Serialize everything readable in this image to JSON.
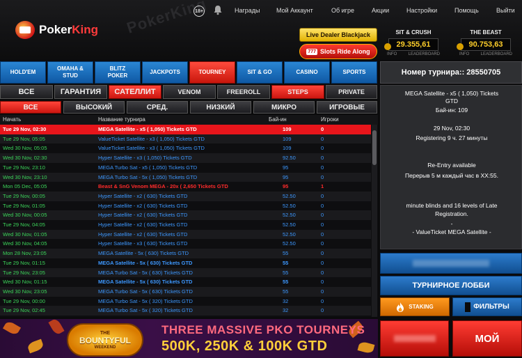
{
  "header": {
    "logo_poker": "Poker",
    "logo_king": "King",
    "watermark": "PokerKing",
    "age": "18+",
    "nav": [
      "Награды",
      "Мой Аккаунт",
      "Об игре",
      "Акции",
      "Настройки",
      "Помощь",
      "Выйти"
    ],
    "live_dealer": "Live Dealer Blackjack",
    "slots_ride": "Slots Ride Along",
    "slots_777": "777",
    "jackpots": [
      {
        "title": "SIT & CRUSH",
        "amount": "29.355,61",
        "info": "INFO",
        "leaderboard": "LEADERBOARD"
      },
      {
        "title": "THE BEAST",
        "amount": "90.753,63",
        "info": "INFO",
        "leaderboard": "LEADERBOARD"
      }
    ]
  },
  "game_tabs": [
    "HOLD'EM",
    "OMAHA & STUD",
    "BLITZ POKER",
    "JACKPOTS",
    "TOURNEY",
    "SIT & GO",
    "CASINO",
    "SPORTS"
  ],
  "filter_row1": [
    "ВСЕ",
    "ГАРАНТИЯ",
    "САТЕЛЛИТ",
    "VENOM",
    "FREEROLL",
    "STEPS",
    "PRIVATE"
  ],
  "filter_row2": [
    "ВСЕ",
    "ВЫСОКИЙ",
    "СРЕД.",
    "НИЗКИЙ",
    "МИКРО",
    "ИГРОВЫЕ"
  ],
  "table": {
    "headers": {
      "start": "Начать",
      "name": "Название турнира",
      "buyin": "Бай-ин",
      "players": "Игроки"
    },
    "rows": [
      {
        "start": "Tue 29 Nov, 02:30",
        "name": "MEGA Satellite - x5 (  1,050) Tickets GTD",
        "buyin": "109",
        "players": "0"
      },
      {
        "start": "Tue 29 Nov, 05:05",
        "name": "ValueTicket Satellite - x3 (  1,050) Tickets GTD",
        "buyin": "109",
        "players": "0"
      },
      {
        "start": "Wed 30 Nov, 05:05",
        "name": "ValueTicket Satellite - x3 (  1,050) Tickets GTD",
        "buyin": "109",
        "players": "0"
      },
      {
        "start": "Wed 30 Nov, 02:30",
        "name": "Hyper Satellite - x3 (  1,050) Tickets GTD",
        "buyin": "92.50",
        "players": "0"
      },
      {
        "start": "Tue 29 Nov, 23:10",
        "name": "MEGA Turbo Sat - x5 (  1,050) Tickets GTD",
        "buyin": "95",
        "players": "0"
      },
      {
        "start": "Wed 30 Nov, 23:10",
        "name": "MEGA Turbo Sat - 5x (  1,050) Tickets GTD",
        "buyin": "95",
        "players": "0"
      },
      {
        "start": "Mon 05 Dec, 05:05",
        "name": "Beast & SnG Venom MEGA - 20x (  2,650 Tickets GTD",
        "buyin": "95",
        "players": "1"
      },
      {
        "start": "Tue 29 Nov, 00:05",
        "name": "Hyper Satellite - x2 (  630) Tickets GTD",
        "buyin": "52.50",
        "players": "0"
      },
      {
        "start": "Tue 29 Nov, 01:05",
        "name": "Hyper Satellite - x2 (  630) Tickets GTD",
        "buyin": "52.50",
        "players": "0"
      },
      {
        "start": "Wed 30 Nov, 00:05",
        "name": "Hyper Satellite - x2 (  630) Tickets GTD",
        "buyin": "52.50",
        "players": "0"
      },
      {
        "start": "Tue 29 Nov, 04:05",
        "name": "Hyper Satellite - x2 (  630) Tickets GTD",
        "buyin": "52.50",
        "players": "0"
      },
      {
        "start": "Wed 30 Nov, 01:05",
        "name": "Hyper Satellite - x2 (  630) Tickets GTD",
        "buyin": "52.50",
        "players": "0"
      },
      {
        "start": "Wed 30 Nov, 04:05",
        "name": "Hyper Satellite - x3 (  630) Tickets GTD",
        "buyin": "52.50",
        "players": "0"
      },
      {
        "start": "Mon 28 Nov, 23:05",
        "name": "MEGA Satellite - 5x (  630) Tickets GTD",
        "buyin": "55",
        "players": "0"
      },
      {
        "start": "Tue 29 Nov, 01:15",
        "name": "MEGA Satellite - 5x (  630) Tickets GTD",
        "buyin": "55",
        "players": "0"
      },
      {
        "start": "Tue 29 Nov, 23:05",
        "name": "MEGA Turbo Sat - 5x (  630) Tickets GTD",
        "buyin": "55",
        "players": "0"
      },
      {
        "start": "Wed 30 Nov, 01:15",
        "name": "MEGA Satellite - 5x (  630) Tickets GTD",
        "buyin": "55",
        "players": "0"
      },
      {
        "start": "Wed 30 Nov, 23:05",
        "name": "MEGA Turbo Sat - 5x (  630) Tickets GTD",
        "buyin": "55",
        "players": "0"
      },
      {
        "start": "Tue 29 Nov, 00:00",
        "name": "MEGA Turbo Sat - 5x (  320) Tickets GTD",
        "buyin": "32",
        "players": "0"
      },
      {
        "start": "Tue 29 Nov, 02:45",
        "name": "MEGA Turbo Sat - 5x (  320) Tickets GTD",
        "buyin": "32",
        "players": "0"
      },
      {
        "start": "Wed 30 Nov, 00:00",
        "name": "MEGA Turbo Sat - 5x (  320) Tickets GTD",
        "buyin": "32",
        "players": "0"
      }
    ]
  },
  "details": {
    "title": "Номер турнира:: 28550705",
    "name_line1": "MEGA Satellite - x5 (  1,050) Tickets",
    "name_line2": "GTD",
    "buyin": "Бай-ин:  109",
    "date": "29 Nov, 02:30",
    "registering": "Registering    9 ч. 27 минуты",
    "reentry": "Re-Entry available",
    "break": "Перерыв 5 м каждый час в XX:55.",
    "blinds_line1": "minute blinds and 16 levels of Late",
    "blinds_line2": "Registration.",
    "dash": "-",
    "value_line": "- ValueTicket MEGA Satellite -"
  },
  "buttons": {
    "lobby": "ТУРНИРНОЕ ЛОББИ",
    "staking": "STAKING",
    "filters": "ФИЛЬТРЫ",
    "my": "МОЙ"
  },
  "banner": {
    "badge_top": "THE",
    "badge_main": "BOUNTYFUL",
    "badge_bottom": "WEEKEND",
    "line1": "THREE MASSIVE PKO TOURNEYS",
    "line2": "500K, 250K & 100K GTD"
  },
  "colors": {
    "accent_red": "#e8151b",
    "accent_blue": "#1f72c4",
    "start_green": "#3cd55a",
    "name_blue": "#3d98ff",
    "jackpot_gold": "#ffcf2a"
  },
  "icons": [
    "bell-icon",
    "flame-icon",
    "age-18-icon",
    "crown-logo-icon"
  ]
}
